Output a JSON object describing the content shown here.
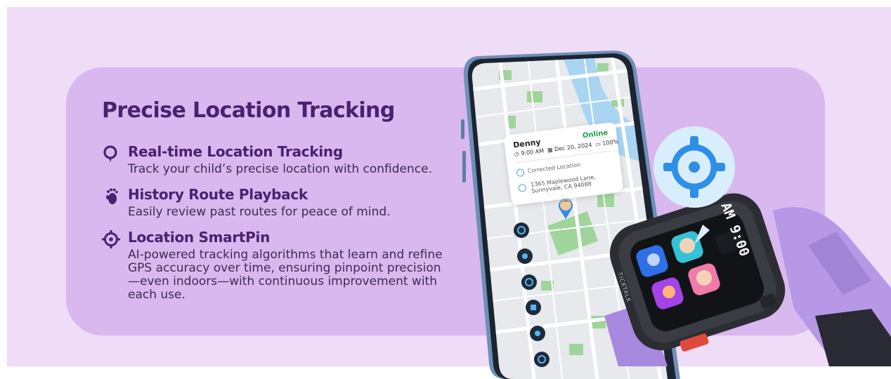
{
  "title": "Precise Location Tracking",
  "features": [
    {
      "icon": "location-pin-icon",
      "title": "Real-time Location Tracking",
      "description": "Track your child’s precise location with confidence."
    },
    {
      "icon": "footprints-icon",
      "title": "History Route Playback",
      "description": "Easily review past routes for peace of mind."
    },
    {
      "icon": "crosshair-icon",
      "title": "Location SmartPin",
      "description": "AI-powered tracking algorithms that learn and refine GPS accuracy over time, ensuring pinpoint precision—even indoors—with continuous improvement with each use."
    }
  ],
  "location_card": {
    "name": "Denny",
    "status": "Online",
    "time": "9:00 AM",
    "date": "Dec 20, 2024",
    "battery": "100%",
    "corrected_label": "Corrected Location",
    "address": "1365 Maplewood Lane, Sunnyvale, CA 94088"
  },
  "watch": {
    "time": "AM 9:00",
    "brand": "TICKTALK"
  },
  "colors": {
    "background": "#efdcf7",
    "panel": "#d8b8ee",
    "heading": "#4a2170",
    "online": "#1aa34a",
    "accent_blue": "#2e8fe8"
  }
}
